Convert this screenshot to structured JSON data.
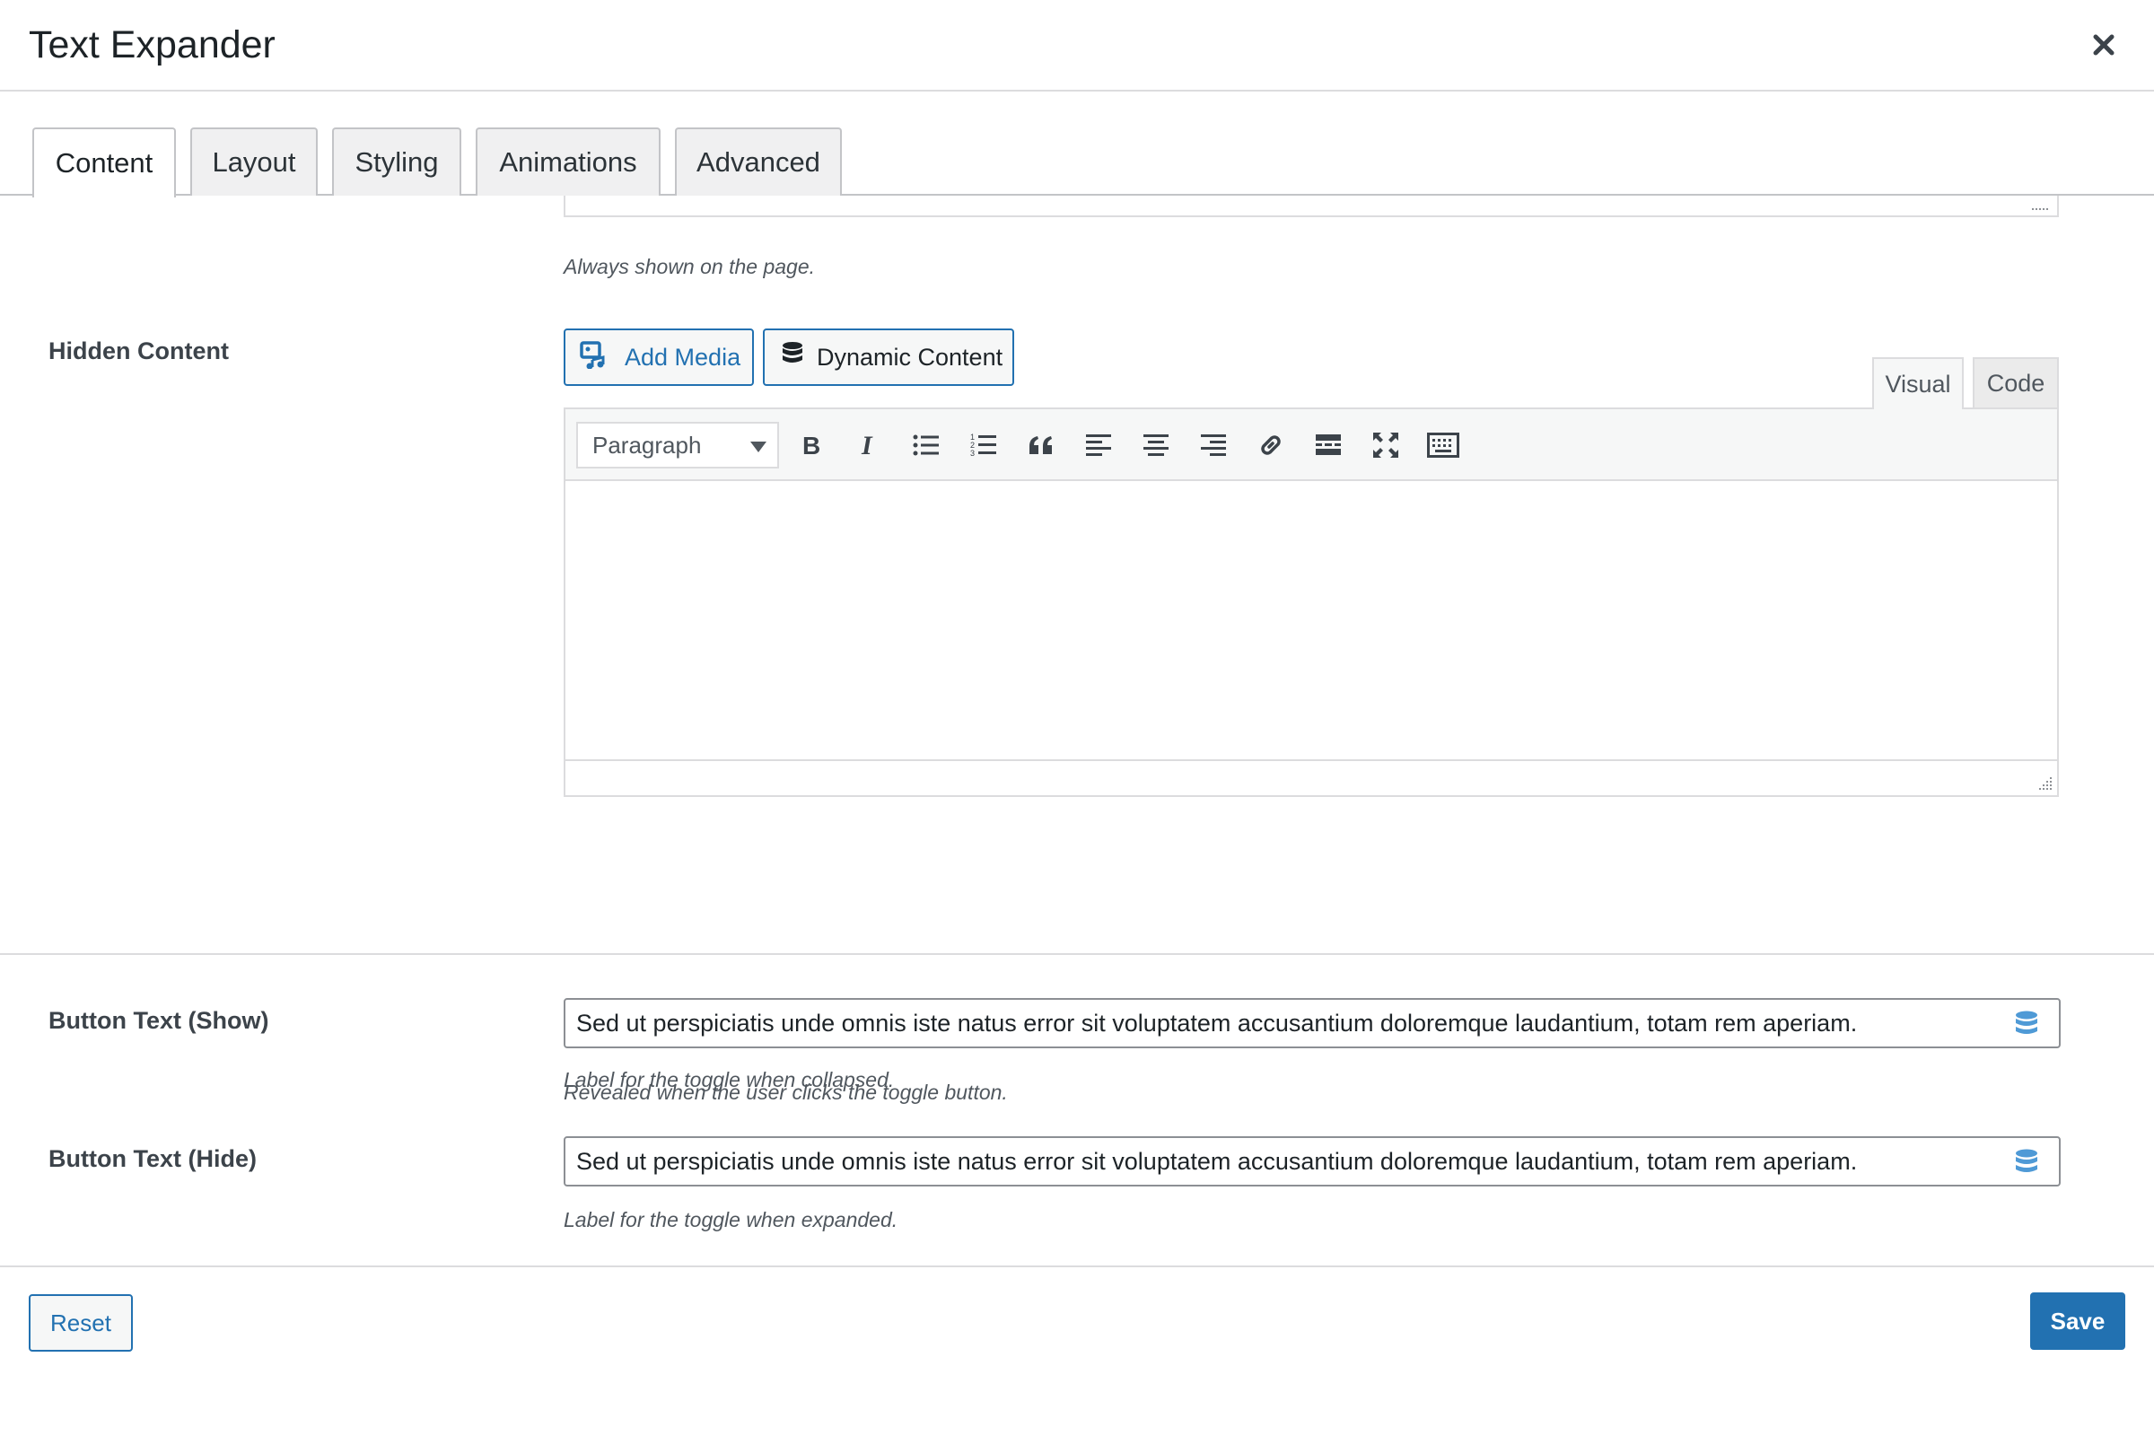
{
  "dialog": {
    "title": "Text Expander"
  },
  "tabs": [
    {
      "label": "Content",
      "active": true
    },
    {
      "label": "Layout",
      "active": false
    },
    {
      "label": "Styling",
      "active": false
    },
    {
      "label": "Animations",
      "active": false
    },
    {
      "label": "Advanced",
      "active": false
    }
  ],
  "visible_content": {
    "help": "Always shown on the page."
  },
  "hidden_content": {
    "label": "Hidden Content",
    "add_media_label": "Add Media",
    "dynamic_content_label": "Dynamic Content",
    "mode_visual": "Visual",
    "mode_code": "Code",
    "format_select_value": "Paragraph",
    "toolbar_icons": [
      "bold-icon",
      "italic-icon",
      "bulleted-list-icon",
      "numbered-list-icon",
      "blockquote-icon",
      "align-left-icon",
      "align-center-icon",
      "align-right-icon",
      "link-icon",
      "read-more-icon",
      "fullscreen-icon",
      "toolbar-toggle-icon"
    ],
    "body_text": "",
    "help": "Revealed when the user clicks the toggle button."
  },
  "button_text_show": {
    "label": "Button Text (Show)",
    "value": "Sed ut perspiciatis unde omnis iste natus error sit voluptatem accusantium doloremque laudantium, totam rem aperiam.",
    "help": "Label for the toggle when collapsed."
  },
  "button_text_hide": {
    "label": "Button Text (Hide)",
    "value": "Sed ut perspiciatis unde omnis iste natus error sit voluptatem accusantium doloremque laudantium, totam rem aperiam.",
    "help": "Label for the toggle when expanded."
  },
  "footer": {
    "reset_label": "Reset",
    "save_label": "Save"
  },
  "colors": {
    "accent": "#2271b1",
    "border": "#dcdcde",
    "db_icon": "#4f9ad6"
  }
}
